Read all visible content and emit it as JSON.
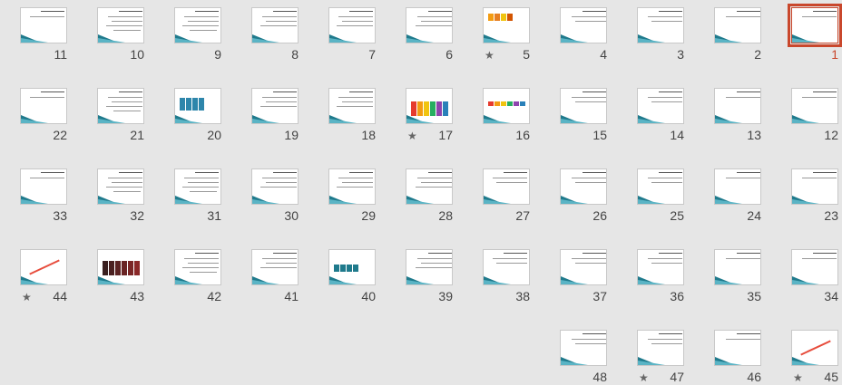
{
  "slide_sorter": {
    "selected_slide": 1,
    "slides": [
      {
        "number": "1",
        "star": false,
        "selected": true
      },
      {
        "number": "2",
        "star": false
      },
      {
        "number": "3",
        "star": false
      },
      {
        "number": "4",
        "star": false
      },
      {
        "number": "5",
        "star": true
      },
      {
        "number": "6",
        "star": false
      },
      {
        "number": "7",
        "star": false
      },
      {
        "number": "8",
        "star": false
      },
      {
        "number": "9",
        "star": false
      },
      {
        "number": "10",
        "star": false
      },
      {
        "number": "11",
        "star": false
      },
      {
        "number": "12",
        "star": false
      },
      {
        "number": "13",
        "star": false
      },
      {
        "number": "14",
        "star": false
      },
      {
        "number": "15",
        "star": false
      },
      {
        "number": "16",
        "star": false
      },
      {
        "number": "17",
        "star": true
      },
      {
        "number": "18",
        "star": false
      },
      {
        "number": "19",
        "star": false
      },
      {
        "number": "20",
        "star": false
      },
      {
        "number": "21",
        "star": false
      },
      {
        "number": "22",
        "star": false
      },
      {
        "number": "23",
        "star": false
      },
      {
        "number": "24",
        "star": false
      },
      {
        "number": "25",
        "star": false
      },
      {
        "number": "26",
        "star": false
      },
      {
        "number": "27",
        "star": false
      },
      {
        "number": "28",
        "star": false
      },
      {
        "number": "29",
        "star": false
      },
      {
        "number": "30",
        "star": false
      },
      {
        "number": "31",
        "star": false
      },
      {
        "number": "32",
        "star": false
      },
      {
        "number": "33",
        "star": false
      },
      {
        "number": "34",
        "star": false
      },
      {
        "number": "35",
        "star": false
      },
      {
        "number": "36",
        "star": false
      },
      {
        "number": "37",
        "star": false
      },
      {
        "number": "38",
        "star": false
      },
      {
        "number": "39",
        "star": false
      },
      {
        "number": "40",
        "star": false
      },
      {
        "number": "41",
        "star": false
      },
      {
        "number": "42",
        "star": false
      },
      {
        "number": "43",
        "star": false
      },
      {
        "number": "44",
        "star": true
      },
      {
        "number": "45",
        "star": true
      },
      {
        "number": "46",
        "star": false
      },
      {
        "number": "47",
        "star": true
      },
      {
        "number": "48",
        "star": false
      }
    ],
    "star_glyph": "★",
    "colors": {
      "background": "#e6e6e6",
      "selection": "#c9472c",
      "accent_teal": "#1f7a8c"
    }
  }
}
